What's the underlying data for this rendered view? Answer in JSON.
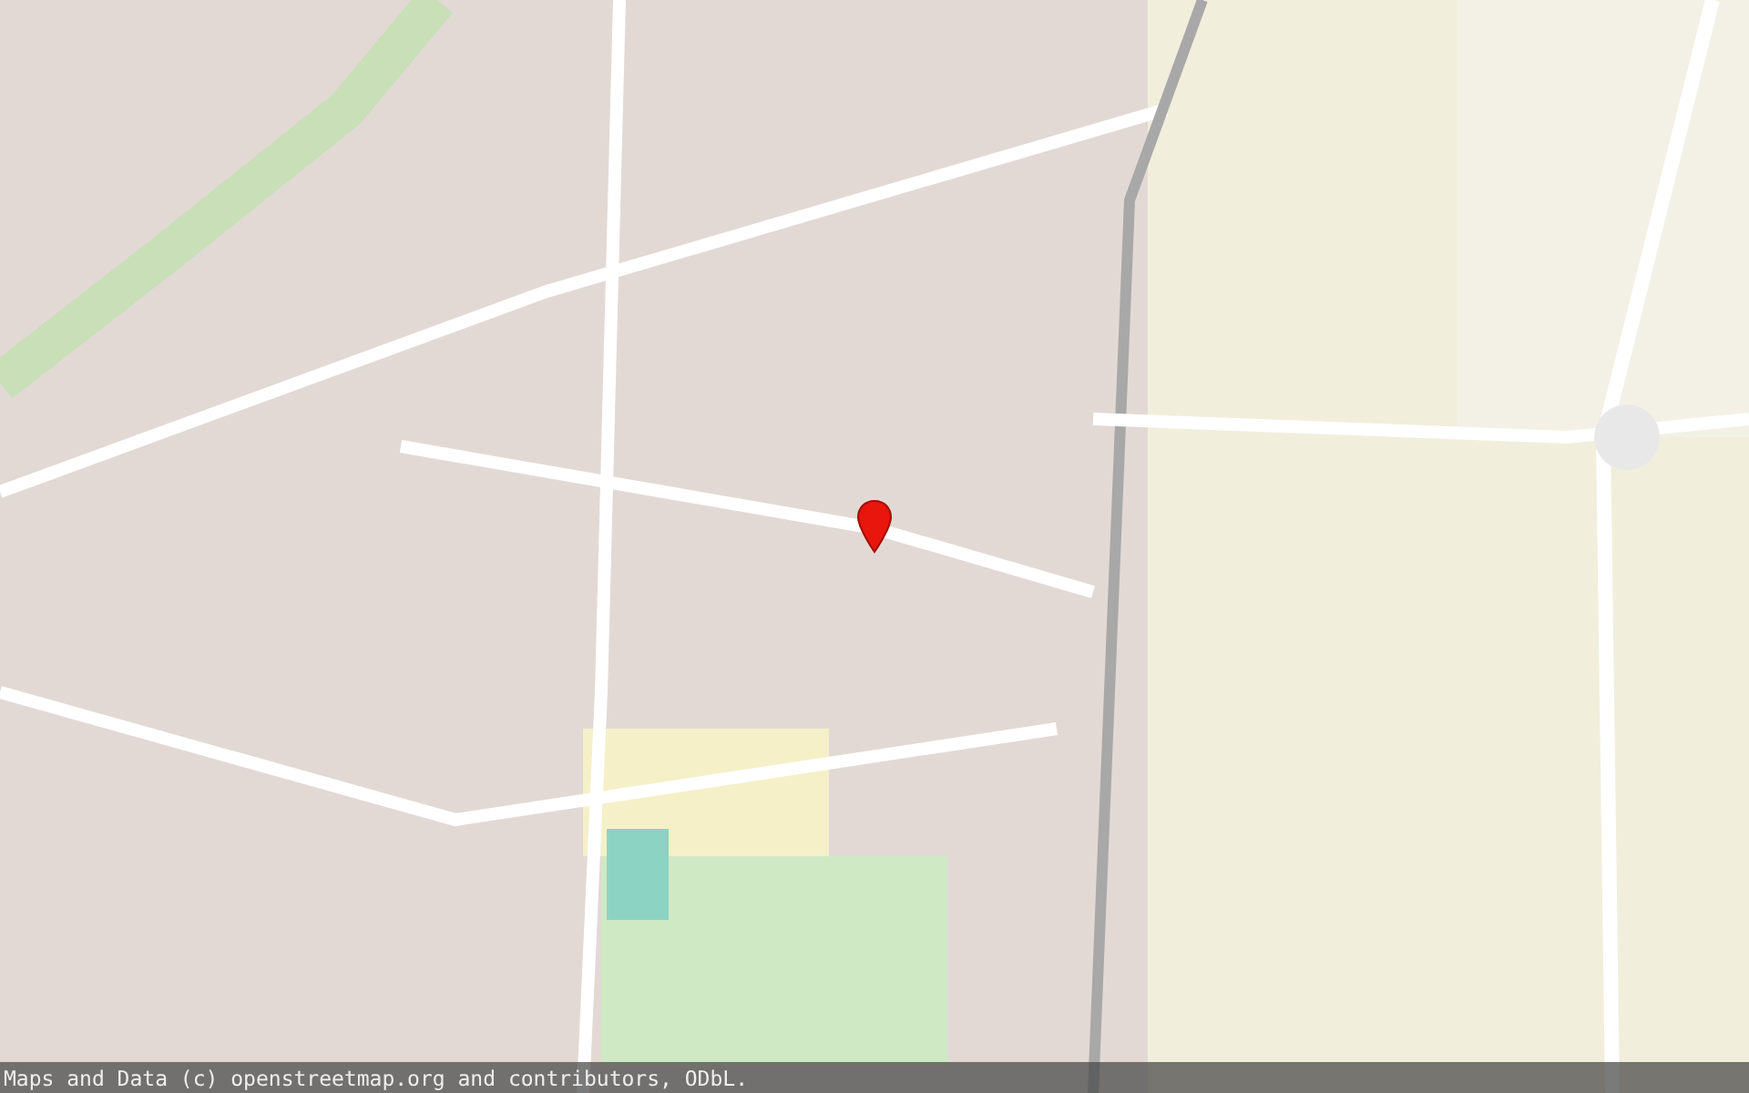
{
  "attribution": "Maps and Data (c) openstreetmap.org and contributors, ODbL."
}
